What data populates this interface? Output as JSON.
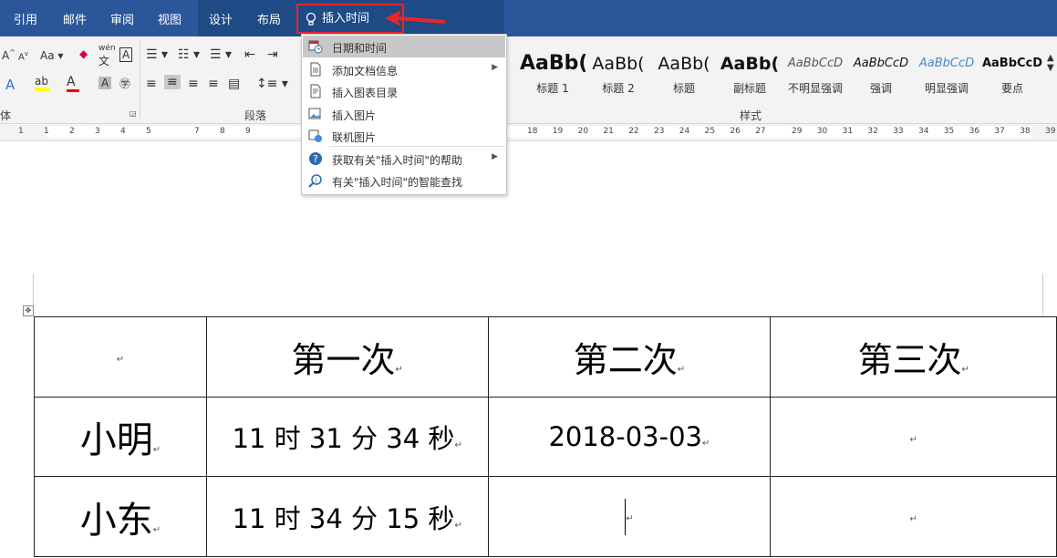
{
  "tabs": [
    "引用",
    "邮件",
    "审阅",
    "视图",
    "设计",
    "布局"
  ],
  "tell_me": "插入时间",
  "ribbon": {
    "group_paragraph": "段落",
    "group_styles": "样式",
    "group_font_partial": "体",
    "font_case": "Aa",
    "wen_label": "wén",
    "wen_char": "文"
  },
  "styles": [
    {
      "preview": "AaBb(",
      "name": "标题 1"
    },
    {
      "preview": "AaBb(",
      "name": "标题 2"
    },
    {
      "preview": "AaBb(",
      "name": "标题"
    },
    {
      "preview": "AaBb(",
      "name": "副标题"
    },
    {
      "preview": "AaBbCcD",
      "name": "不明显强调"
    },
    {
      "preview": "AaBbCcD",
      "name": "强调"
    },
    {
      "preview": "AaBbCcD",
      "name": "明显强调"
    },
    {
      "preview": "AaBbCcD",
      "name": "要点"
    }
  ],
  "menu": [
    {
      "label": "日期和时间",
      "icon": "calendar-clock-icon",
      "submenu": false
    },
    {
      "label": "添加文档信息",
      "icon": "document-info-icon",
      "submenu": true
    },
    {
      "label": "插入图表目录",
      "icon": "figure-list-icon",
      "submenu": false
    },
    {
      "label": "插入图片",
      "icon": "picture-icon",
      "submenu": false
    },
    {
      "label": "联机图片",
      "icon": "online-picture-icon",
      "submenu": false
    },
    {
      "label": "获取有关\"插入时间\"的帮助",
      "icon": "help-icon",
      "submenu": true
    },
    {
      "label": "有关\"插入时间\"的智能查找",
      "icon": "smart-lookup-icon",
      "submenu": false
    }
  ],
  "ruler_left": [
    "1",
    "1",
    "2",
    "3",
    "4",
    "5",
    "7",
    "8",
    "9"
  ],
  "ruler_right": [
    "18",
    "19",
    "20",
    "21",
    "22",
    "23",
    "24",
    "25",
    "26",
    "27",
    "29",
    "30",
    "31",
    "32",
    "33",
    "34",
    "35",
    "36",
    "37",
    "38",
    "39"
  ],
  "table": {
    "header": [
      "",
      "第一次",
      "第二次",
      "第三次"
    ],
    "rows": [
      [
        "小明",
        "11 时 31 分 34 秒",
        "2018-03-03",
        ""
      ],
      [
        "小东",
        "11 时 34 分 15 秒",
        "",
        ""
      ]
    ]
  },
  "colors": {
    "ribbon_blue": "#2b579a",
    "highlight_red": "#e8262b"
  }
}
